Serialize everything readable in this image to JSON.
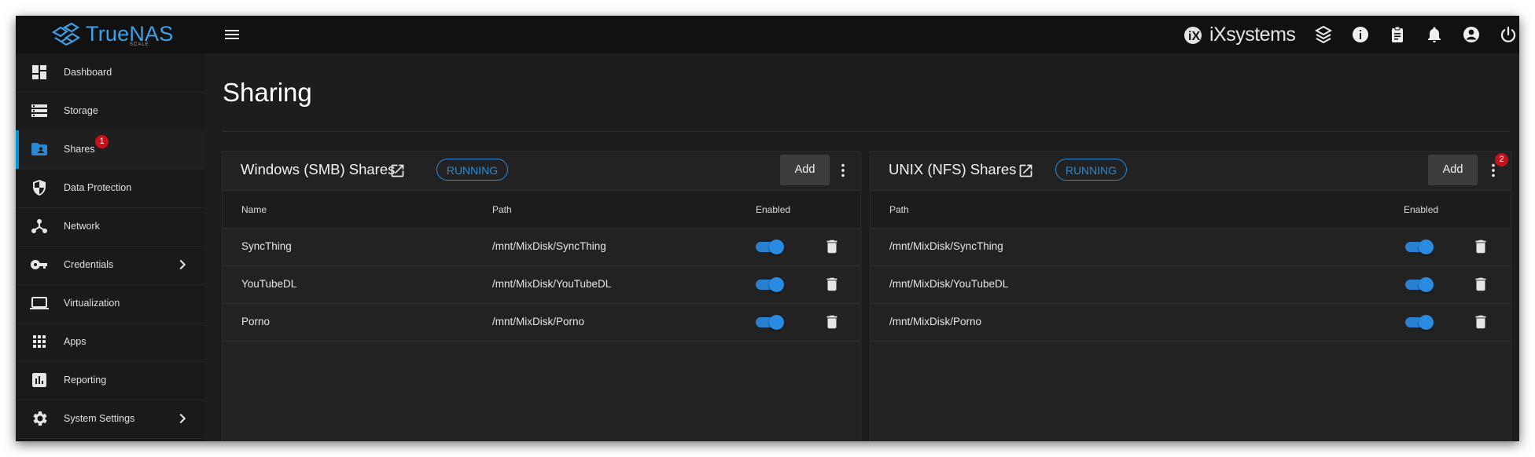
{
  "brand": {
    "name": "TrueNAS",
    "edition": "SCALE",
    "vendor_logo_text": "iXsystems"
  },
  "colors": {
    "accent": "#2b8ad6",
    "badge": "#c7111a",
    "background": "#1d1d1d"
  },
  "topbar": {
    "icons": [
      "menu-icon",
      "truecommand-icon",
      "info-icon",
      "clipboard-icon",
      "bell-icon",
      "account-icon",
      "power-icon"
    ]
  },
  "sidebar": {
    "items": [
      {
        "label": "Dashboard",
        "icon": "dashboard-icon"
      },
      {
        "label": "Storage",
        "icon": "storage-icon"
      },
      {
        "label": "Shares",
        "icon": "shares-icon",
        "badge": "1",
        "active": true
      },
      {
        "label": "Data Protection",
        "icon": "shield-icon"
      },
      {
        "label": "Network",
        "icon": "network-icon"
      },
      {
        "label": "Credentials",
        "icon": "key-icon",
        "has_submenu": true
      },
      {
        "label": "Virtualization",
        "icon": "laptop-icon"
      },
      {
        "label": "Apps",
        "icon": "apps-grid-icon"
      },
      {
        "label": "Reporting",
        "icon": "chart-icon"
      },
      {
        "label": "System Settings",
        "icon": "gear-icon",
        "has_submenu": true
      }
    ]
  },
  "main": {
    "title": "Sharing",
    "smb": {
      "title": "Windows (SMB) Shares",
      "status": "RUNNING",
      "add_label": "Add",
      "columns": {
        "name": "Name",
        "path": "Path",
        "enabled": "Enabled"
      },
      "rows": [
        {
          "name": "SyncThing",
          "path": "/mnt/MixDisk/SyncThing",
          "enabled": true
        },
        {
          "name": "YouTubeDL",
          "path": "/mnt/MixDisk/YouTubeDL",
          "enabled": true
        },
        {
          "name": "Porno",
          "path": "/mnt/MixDisk/Porno",
          "enabled": true
        }
      ]
    },
    "nfs": {
      "title": "UNIX (NFS) Shares",
      "status": "RUNNING",
      "add_label": "Add",
      "menu_badge": "2",
      "columns": {
        "path": "Path",
        "enabled": "Enabled"
      },
      "rows": [
        {
          "path": "/mnt/MixDisk/SyncThing",
          "enabled": true
        },
        {
          "path": "/mnt/MixDisk/YouTubeDL",
          "enabled": true
        },
        {
          "path": "/mnt/MixDisk/Porno",
          "enabled": true
        }
      ]
    }
  }
}
